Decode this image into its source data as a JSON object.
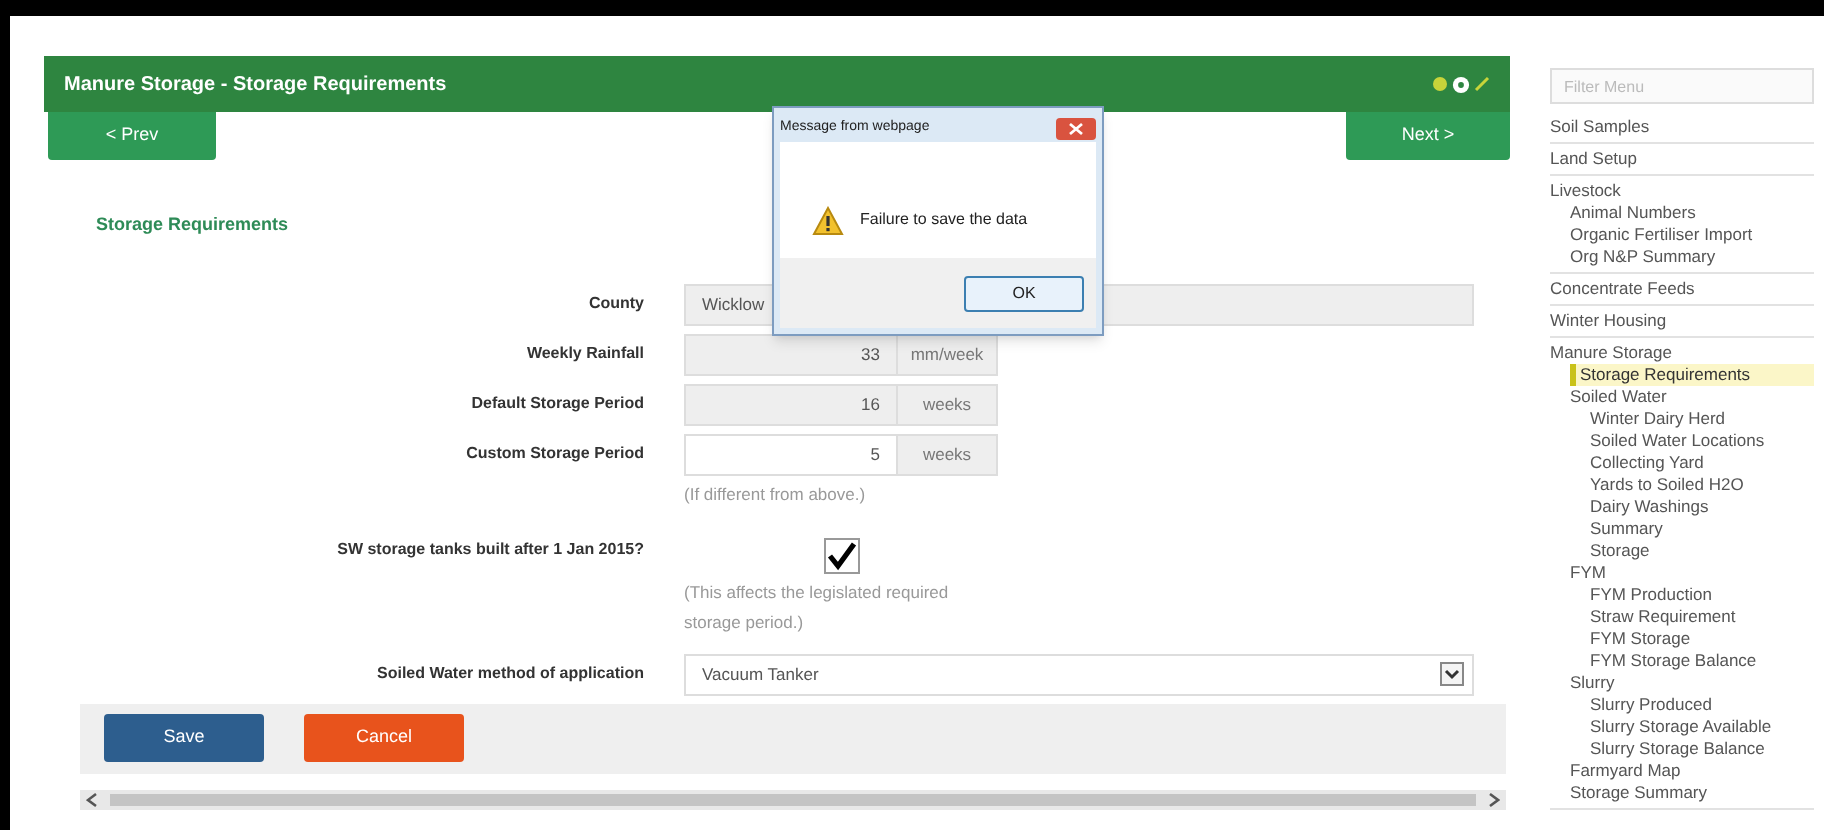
{
  "page_title": "Manure Storage - Storage Requirements",
  "nav": {
    "prev": "< Prev",
    "next": "Next >"
  },
  "section_title": "Storage Requirements",
  "fields": [
    {
      "kind": "text",
      "label": "County",
      "value": "Wicklow",
      "disabled": true
    },
    {
      "kind": "number",
      "label": "Weekly Rainfall",
      "value": "33",
      "unit": "mm/week",
      "disabled": true
    },
    {
      "kind": "number",
      "label": "Default Storage Period",
      "value": "16",
      "unit": "weeks",
      "disabled": true
    },
    {
      "kind": "number",
      "label": "Custom Storage Period",
      "value": "5",
      "unit": "weeks",
      "disabled": false,
      "hint": "(If different from above.)"
    },
    {
      "kind": "checkbox",
      "label": "SW storage tanks built after 1 Jan 2015?",
      "checked": true,
      "hint": "(This affects the legislated required storage period.)"
    },
    {
      "kind": "select",
      "label": "Soiled Water method of application",
      "value": "Vacuum Tanker"
    }
  ],
  "actions": [
    {
      "kind": "primary",
      "label": "Save"
    },
    {
      "kind": "danger",
      "label": "Cancel"
    }
  ],
  "dialog": {
    "title": "Message from webpage",
    "message": "Failure to save the data",
    "button": "OK"
  },
  "sidebar": {
    "filter_placeholder": "Filter Menu",
    "items": [
      {
        "label": "Soil Samples",
        "selected": false
      },
      {
        "label": "Land Setup",
        "selected": false
      },
      {
        "label": "Livestock",
        "selected": false,
        "children": [
          {
            "label": "Animal Numbers",
            "selected": false
          },
          {
            "label": "Organic Fertiliser Import",
            "selected": false
          },
          {
            "label": "Org N&P Summary",
            "selected": false
          }
        ]
      },
      {
        "label": "Concentrate Feeds",
        "selected": false
      },
      {
        "label": "Winter Housing",
        "selected": false
      },
      {
        "label": "Manure Storage",
        "selected": false,
        "children": [
          {
            "label": "Storage Requirements",
            "selected": true
          },
          {
            "label": "Soiled Water",
            "selected": false,
            "children": [
              {
                "label": "Winter Dairy Herd",
                "selected": false
              },
              {
                "label": "Soiled Water Locations",
                "selected": false
              },
              {
                "label": "Collecting Yard",
                "selected": false
              },
              {
                "label": "Yards to Soiled H2O",
                "selected": false
              },
              {
                "label": "Dairy Washings",
                "selected": false
              },
              {
                "label": "Summary",
                "selected": false
              },
              {
                "label": "Storage",
                "selected": false
              }
            ]
          },
          {
            "label": "FYM",
            "selected": false,
            "children": [
              {
                "label": "FYM Production",
                "selected": false
              },
              {
                "label": "Straw Requirement",
                "selected": false
              },
              {
                "label": "FYM Storage",
                "selected": false
              },
              {
                "label": "FYM Storage Balance",
                "selected": false
              }
            ]
          },
          {
            "label": "Slurry",
            "selected": false,
            "children": [
              {
                "label": "Slurry Produced",
                "selected": false
              },
              {
                "label": "Slurry Storage Available",
                "selected": false
              },
              {
                "label": "Slurry Storage Balance",
                "selected": false
              }
            ]
          },
          {
            "label": "Farmyard Map",
            "selected": false
          },
          {
            "label": "Storage Summary",
            "selected": false
          }
        ]
      }
    ]
  }
}
